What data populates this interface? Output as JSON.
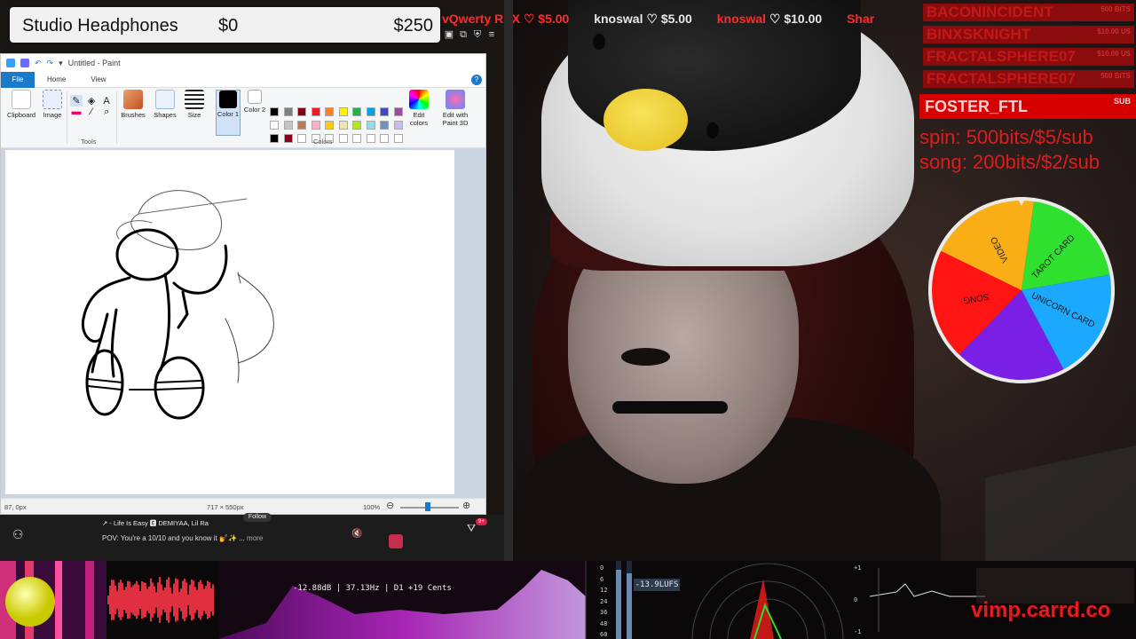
{
  "goal": {
    "title": "Studio Headphones",
    "current": "$0",
    "target": "$250"
  },
  "ticker": [
    {
      "name": "vQwerty RSX",
      "amount": "$5.00"
    },
    {
      "name": "knoswal",
      "amount": "$5.00"
    },
    {
      "name": "knoswal",
      "amount": "$10.00"
    },
    {
      "name": "Shar",
      "amount": ""
    }
  ],
  "tippers": [
    {
      "name": "BACONINCIDENT",
      "amount": "500 BITS"
    },
    {
      "name": "BINXSKNIGHT",
      "amount": "$10.00 US"
    },
    {
      "name": "FRACTALSPHERE07",
      "amount": "$10.00 US"
    },
    {
      "name": "FRACTALSPHERE07",
      "amount": "500 BITS"
    }
  ],
  "top_tipper": {
    "name": "FOSTER_FTL",
    "badge": "SUB"
  },
  "pricing": {
    "spin": "spin: 500bits/$5/sub",
    "song": "song: 200bits/$2/sub"
  },
  "wheel": {
    "segments": [
      {
        "label": "TAROT CARD",
        "color": "#2fe02f"
      },
      {
        "label": "UNICORN CARD",
        "color": "#1aa9ff"
      },
      {
        "label": "",
        "color": "#7a1fe6"
      },
      {
        "label": "SONG",
        "color": "#ff1414"
      },
      {
        "label": "VIDEO",
        "color": "#f8ae14"
      }
    ]
  },
  "paint": {
    "title": "Untitled - Paint",
    "tabs": {
      "file": "File",
      "home": "Home",
      "view": "View",
      "help": "?"
    },
    "ribbon": {
      "clipboard": "Clipboard",
      "image": "Image",
      "tools": "Tools",
      "brushes": "Brushes",
      "shapes": "Shapes",
      "size": "Size",
      "color1": "Color 1",
      "color2": "Color 2",
      "colors": "Colors",
      "edit_colors": "Edit colors",
      "edit_paint3d": "Edit with Paint 3D"
    },
    "palette": [
      "#000000",
      "#7f7f7f",
      "#880015",
      "#ed1c24",
      "#ff7f27",
      "#fff200",
      "#22b14c",
      "#00a2e8",
      "#3f48cc",
      "#a349a4",
      "#ffffff",
      "#c3c3c3",
      "#b97a57",
      "#ffaec9",
      "#ffc90e",
      "#efe4b0",
      "#b5e61d",
      "#99d9ea",
      "#7092be",
      "#c8bfe7",
      "#000000",
      "#880015",
      "#ffffff",
      "#ffffff",
      "#ffffff",
      "#ffffff",
      "#ffffff",
      "#ffffff",
      "#ffffff",
      "#ffffff"
    ],
    "status": {
      "cursor": "87, 0px",
      "size": "717 × 550px",
      "zoom": "100%"
    }
  },
  "strip": {
    "chip": "↗ - Life Is Easy 🅴 DEMIYAA, Lil Ra",
    "follow": "Follow",
    "caption": "POV: You're a 10/10 and you know it 💅✨ ...",
    "more": "more",
    "notif_badge": "9+"
  },
  "viz": {
    "readout": "-12.88dB | 37.13Hz | D1  +19 Cents",
    "lufs": "-13.9LUFS",
    "meter_ticks": [
      "0",
      "6",
      "12",
      "24",
      "36",
      "48",
      "60"
    ],
    "right_ticks": [
      "+1",
      "0",
      "-1"
    ]
  },
  "overlay_url": "vimp.carrd.co"
}
